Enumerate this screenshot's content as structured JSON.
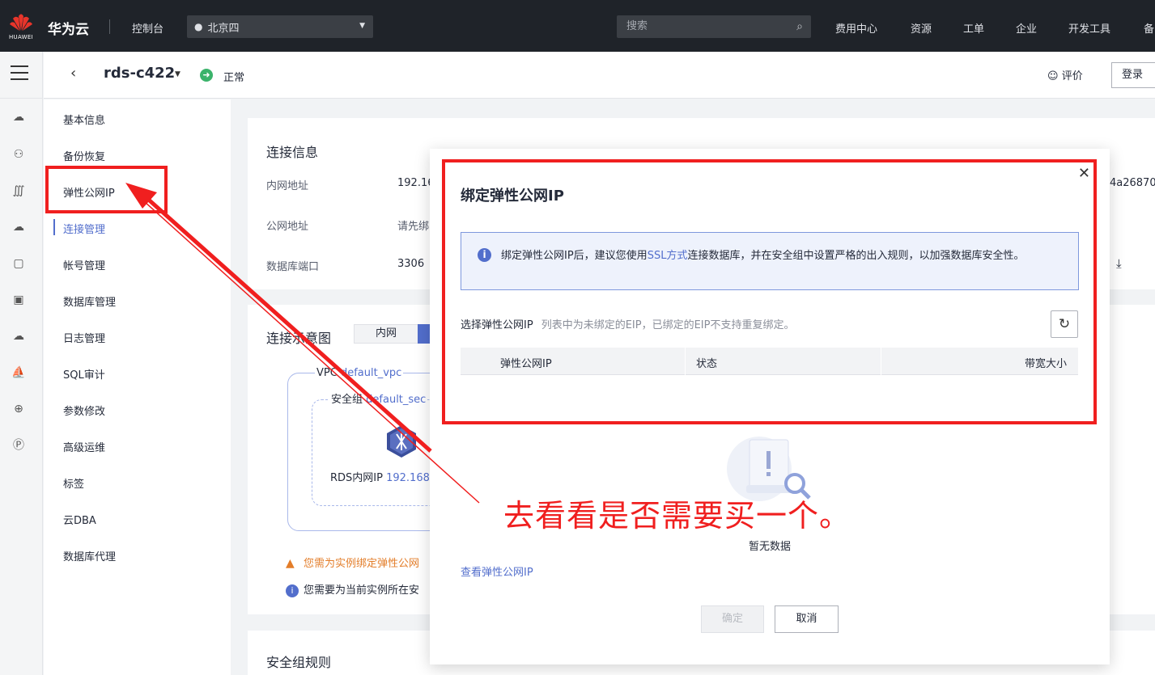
{
  "topbar": {
    "logo_text": "HUAWEI",
    "brand": "华为云",
    "console": "控制台",
    "region": "北京四",
    "search_placeholder": "搜索",
    "nav": [
      "费用中心",
      "资源",
      "工单",
      "企业",
      "开发工具",
      "备"
    ]
  },
  "header": {
    "instance_name": "rds-c422",
    "status": "正常",
    "rate": "评价",
    "login_button": "登录"
  },
  "left_menu": {
    "items": [
      "基本信息",
      "备份恢复",
      "弹性公网IP",
      "连接管理",
      "帐号管理",
      "数据库管理",
      "日志管理",
      "SQL审计",
      "参数修改",
      "高级运维",
      "标签",
      "云DBA",
      "数据库代理"
    ],
    "active": "连接管理"
  },
  "connection_card": {
    "title": "连接信息",
    "labels": [
      "内网地址",
      "公网地址",
      "数据库端口"
    ],
    "values": [
      "192.16",
      "请先绑",
      "3306"
    ],
    "right_partial": "4a26870"
  },
  "diagram_card": {
    "title": "连接示意图",
    "tab_internal": "内网",
    "vpc_label": "VPC",
    "vpc_name": "default_vpc",
    "sg_label": "安全组",
    "sg_name": "default_sec",
    "rds_label": "RDS内网IP",
    "rds_ip": "192.168",
    "warning": "您需为实例绑定弹性公网",
    "info": "您需要为当前实例所在安"
  },
  "security_card": {
    "title": "安全组规则"
  },
  "modal": {
    "title": "绑定弹性公网IP",
    "alert_prefix": "绑定弹性公网IP后，建议您使用",
    "alert_link": "SSL方式",
    "alert_suffix": "连接数据库，并在安全组中设置严格的出入规则，以加强数据库安全性。",
    "select_label": "选择弹性公网IP",
    "select_hint": "列表中为未绑定的EIP，已绑定的EIP不支持重复绑定。",
    "columns": [
      "弹性公网IP",
      "状态",
      "带宽大小"
    ],
    "empty_text": "暂无数据",
    "view_link": "查看弹性公网IP",
    "ok": "确定",
    "cancel": "取消"
  },
  "annotation": {
    "text": "去看看是否需要买一个。",
    "color": "#f01f1f"
  }
}
